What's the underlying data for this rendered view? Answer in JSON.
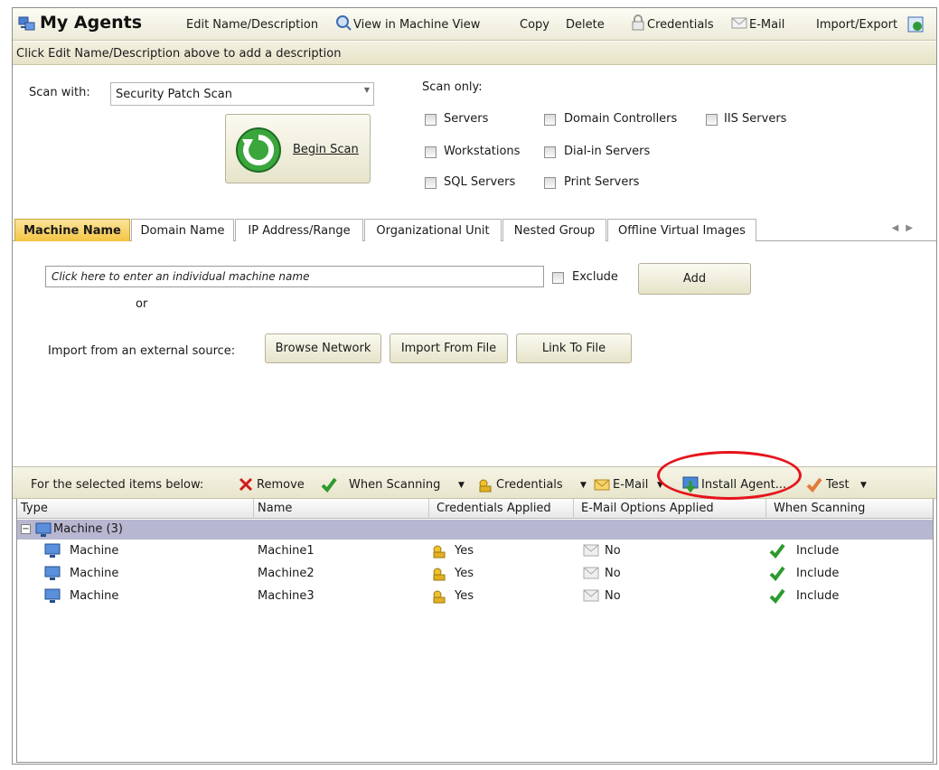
{
  "header": {
    "title": "My Agents",
    "edit": "Edit Name/Description",
    "view": "View in Machine View",
    "copy": "Copy",
    "delete": "Delete",
    "credentials": "Credentials",
    "email": "E-Mail",
    "import_export": "Import/Export"
  },
  "description_hint": "Click Edit Name/Description above to add a description",
  "scan": {
    "with_label": "Scan with:",
    "template": "Security Patch Scan",
    "begin": "Begin Scan",
    "only_label": "Scan only:",
    "options": {
      "servers": "Servers",
      "domain_controllers": "Domain Controllers",
      "iis_servers": "IIS Servers",
      "workstations": "Workstations",
      "dialin_servers": "Dial-in Servers",
      "sql_servers": "SQL Servers",
      "print_servers": "Print Servers"
    }
  },
  "tabs": [
    "Machine Name",
    "Domain Name",
    "IP Address/Range",
    "Organizational Unit",
    "Nested Group",
    "Offline Virtual Images"
  ],
  "machine_panel": {
    "placeholder": "Click here to enter an individual machine name",
    "exclude": "Exclude",
    "add": "Add",
    "or": "or",
    "import_label": "Import from an external source:",
    "browse": "Browse Network",
    "import_file": "Import From File",
    "link_file": "Link To File"
  },
  "selection_bar": {
    "label": "For the selected items below:",
    "remove": "Remove",
    "when_scanning": "When Scanning",
    "credentials": "Credentials",
    "email": "E-Mail",
    "install_agent": "Install Agent...",
    "test": "Test"
  },
  "grid": {
    "columns": [
      "Type",
      "Name",
      "Credentials Applied",
      "E-Mail Options Applied",
      "When Scanning"
    ],
    "group": "Machine (3)",
    "rows": [
      {
        "type": "Machine",
        "name": "Machine1",
        "credentials": "Yes",
        "email": "No",
        "when": "Include"
      },
      {
        "type": "Machine",
        "name": "Machine2",
        "credentials": "Yes",
        "email": "No",
        "when": "Include"
      },
      {
        "type": "Machine",
        "name": "Machine3",
        "credentials": "Yes",
        "email": "No",
        "when": "Include"
      }
    ]
  },
  "colors": {
    "active_tab": "#f4c443",
    "group_row": "#b8b7d1",
    "highlight_ellipse": "#e6141c"
  }
}
